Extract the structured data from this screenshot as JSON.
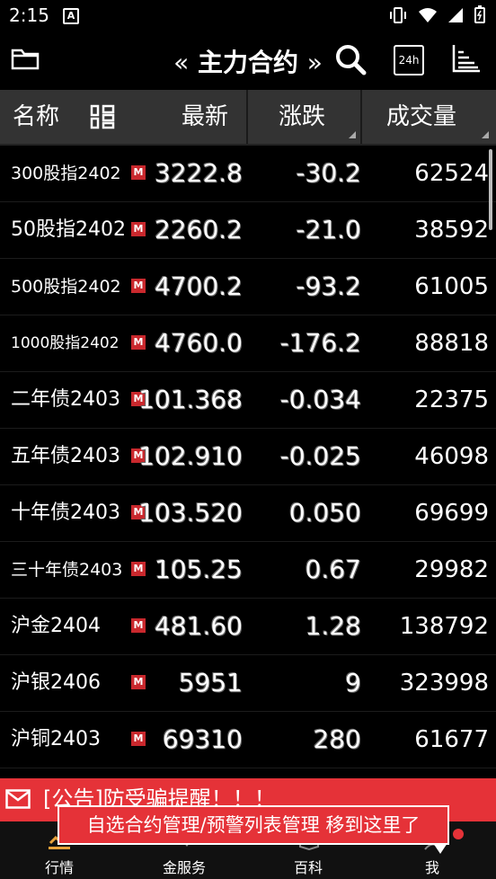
{
  "status": {
    "time": "2:15",
    "a": "A"
  },
  "nav": {
    "title": "主力合约",
    "left_arrow": "«",
    "right_arrow": "»",
    "h24": "24h"
  },
  "header": {
    "name": "名称",
    "last": "最新",
    "change": "涨跌",
    "volume": "成交量"
  },
  "rows": [
    {
      "name": "300股指2402",
      "size": "small",
      "last": "3222.8",
      "change": "-30.2",
      "volume": "62524"
    },
    {
      "name": "50股指2402",
      "size": "",
      "last": "2260.2",
      "change": "-21.0",
      "volume": "38592"
    },
    {
      "name": "500股指2402",
      "size": "small",
      "last": "4700.2",
      "change": "-93.2",
      "volume": "61005"
    },
    {
      "name": "1000股指2402",
      "size": "xsmall",
      "last": "4760.0",
      "change": "-176.2",
      "volume": "88818"
    },
    {
      "name": "二年债2403",
      "size": "",
      "last": "101.368",
      "change": "-0.034",
      "volume": "22375"
    },
    {
      "name": "五年债2403",
      "size": "",
      "last": "102.910",
      "change": "-0.025",
      "volume": "46098"
    },
    {
      "name": "十年债2403",
      "size": "",
      "last": "103.520",
      "change": "0.050",
      "volume": "69699"
    },
    {
      "name": "三十年债2403",
      "size": "small",
      "last": "105.25",
      "change": "0.67",
      "volume": "29982"
    },
    {
      "name": "沪金2404",
      "size": "",
      "last": "481.60",
      "change": "1.28",
      "volume": "138792"
    },
    {
      "name": "沪银2406",
      "size": "",
      "last": "5951",
      "change": "9",
      "volume": "323998"
    },
    {
      "name": "沪铜2403",
      "size": "",
      "last": "69310",
      "change": "280",
      "volume": "61677"
    }
  ],
  "m_badge": "M",
  "notice": {
    "text": "[公告]防受骗提醒！！！"
  },
  "tip": {
    "text": "自选合约管理/预警列表管理 移到这里了"
  },
  "tabs": [
    {
      "label": "行情"
    },
    {
      "label": "金服务"
    },
    {
      "label": "百科"
    },
    {
      "label": "我"
    }
  ]
}
